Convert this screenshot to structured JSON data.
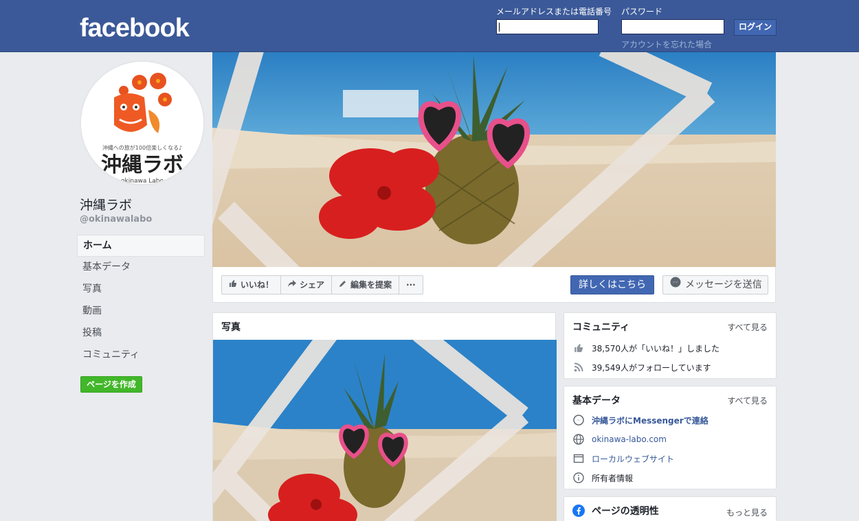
{
  "header": {
    "logo": "facebook",
    "email_label": "メールアドレスまたは電話番号",
    "password_label": "パスワード",
    "login_button": "ログイン",
    "forgot_link": "アカウントを忘れた場合",
    "brand_color": "#3b5998"
  },
  "profile": {
    "avatar_top_text": "沖縄への旅が100倍楽しくなる♪",
    "avatar_main_text": "沖縄ラボ",
    "avatar_sub_text": "okinawa Labo",
    "name": "沖縄ラボ",
    "handle": "@okinawalabo"
  },
  "nav": {
    "items": [
      "ホーム",
      "基本データ",
      "写真",
      "動画",
      "投稿",
      "コミュニティ"
    ],
    "create_page": "ページを作成"
  },
  "actions": {
    "like": "いいね！",
    "share": "シェア",
    "suggest_edit": "編集を提案",
    "more": "···",
    "cta": "詳しくはこちら",
    "message": "メッセージを送信"
  },
  "photos": {
    "title": "写真"
  },
  "community": {
    "title": "コミュニティ",
    "see_all": "すべて見る",
    "likes": "38,570人が「いいね！」しました",
    "follows": "39,549人がフォローしています"
  },
  "about": {
    "title": "基本データ",
    "see_all": "すべて見る",
    "messenger": "沖縄ラボにMessengerで連絡",
    "website": "okinawa-labo.com",
    "category": "ローカルウェブサイト",
    "owner": "所有者情報"
  },
  "transparency": {
    "title": "ページの透明性",
    "see_more": "もっと見る"
  }
}
